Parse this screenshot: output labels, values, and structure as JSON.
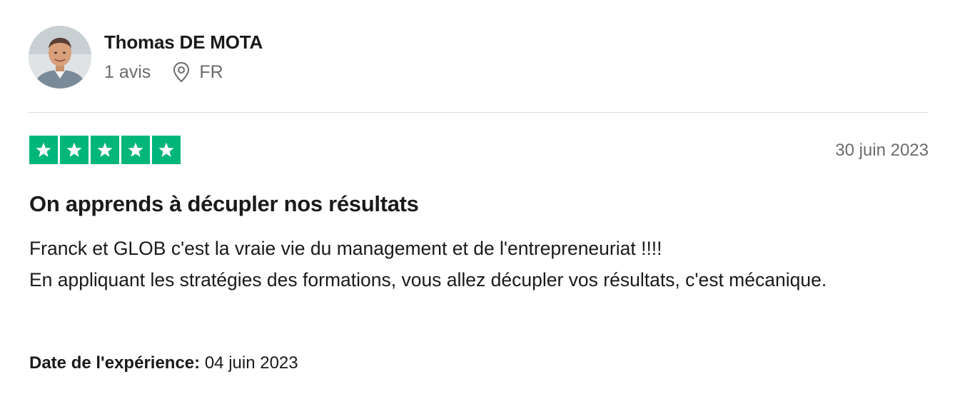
{
  "consumer": {
    "avatar_icon": "user-photo-avatar",
    "name": "Thomas DE MOTA",
    "reviews_count": "1 avis",
    "location_icon": "map-pin-icon",
    "country": "FR"
  },
  "review": {
    "rating": 5,
    "rating_max": 5,
    "star_color": "#00b67a",
    "date": "30 juin 2023",
    "title": "On apprends à décupler nos résultats",
    "body_lines": [
      "Franck et GLOB c'est la vraie vie du management et de l'entrepreneuriat !!!!",
      "En appliquant les stratégies des formations, vous allez décupler vos résultats, c'est mécanique."
    ],
    "experience_label": "Date de l'expérience:",
    "experience_date": "04 juin 2023"
  }
}
